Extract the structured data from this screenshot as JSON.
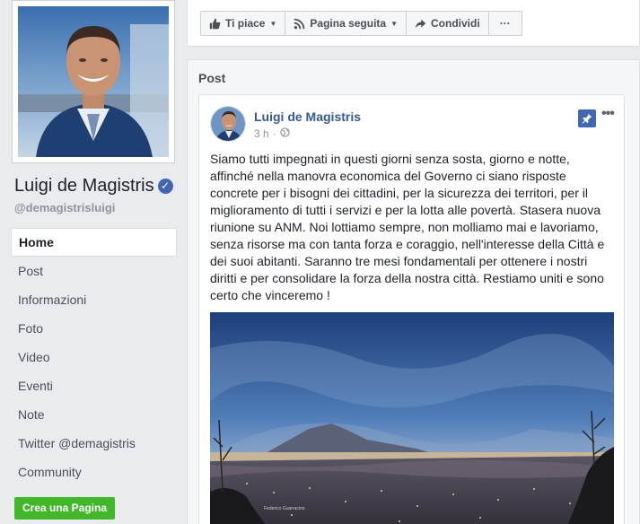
{
  "sidebar": {
    "page_name": "Luigi de Magistris",
    "handle": "@demagistrisluigi",
    "nav": [
      {
        "label": "Home",
        "active": true
      },
      {
        "label": "Post"
      },
      {
        "label": "Informazioni"
      },
      {
        "label": "Foto"
      },
      {
        "label": "Video"
      },
      {
        "label": "Eventi"
      },
      {
        "label": "Note"
      },
      {
        "label": "Twitter @demagistris"
      },
      {
        "label": "Community"
      }
    ],
    "create_page": "Crea una Pagina"
  },
  "actions": {
    "like": "Ti piace",
    "follow": "Pagina seguita",
    "share": "Condividi",
    "more": "···"
  },
  "posts": {
    "section_title": "Post",
    "post": {
      "author": "Luigi de Magistris",
      "time": "3 h",
      "privacy_icon": "globe-icon",
      "lines": [
        "Siamo tutti impegnati in questi giorni senza sosta, giorno e notte,",
        "affinché nella manovra economica del Governo ci siano risposte",
        "concrete per i bisogni dei cittadini, per la sicurezza dei territori, per il",
        "miglioramento di tutti i servizi e per la lotta alle povertà. Stasera nuova",
        "riunione su ANM. Noi lottiamo sempre, non molliamo mai e lavoriamo,",
        "senza risorse ma con tanta forza e coraggio, nell'interesse della Città e",
        "dei suoi abitanti. Saranno tre mesi fondamentali per ottenere i nostri",
        "diritti e per consolidare la forza della nostra città. Restiamo uniti e sono",
        "certo che vinceremo !"
      ],
      "photo_credit": "Federico Guarracino"
    }
  },
  "colors": {
    "link": "#365899",
    "brand": "#4267b2",
    "green": "#42b72a"
  }
}
